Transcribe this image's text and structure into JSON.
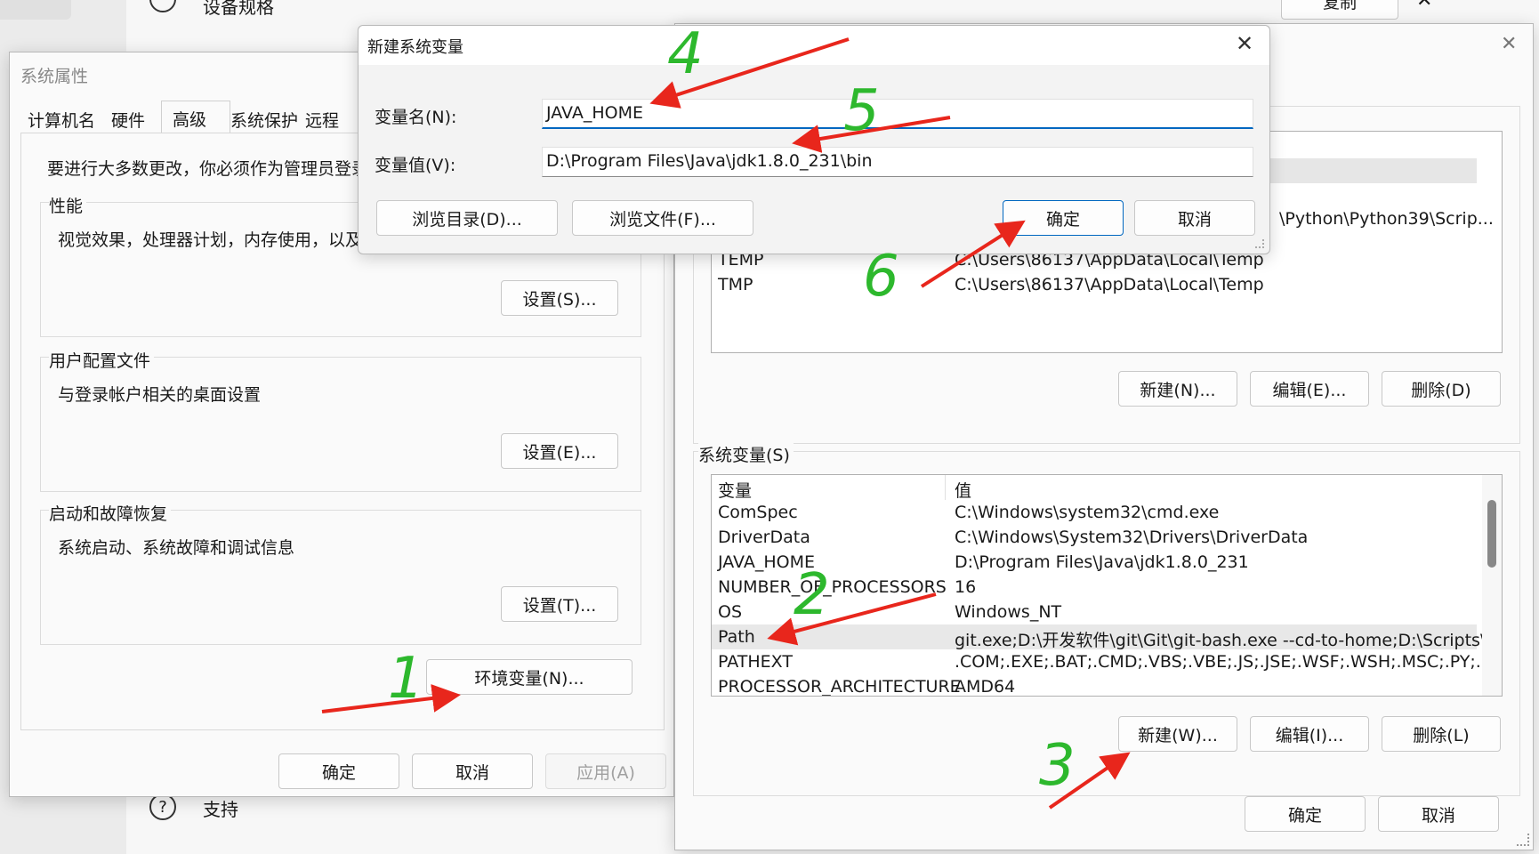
{
  "background_app": {
    "device_specs_label": "设备规格",
    "copy_button": "复制",
    "support_label": "支持",
    "close_glyph": "✕"
  },
  "system_properties": {
    "title": "系统属性",
    "tabs": [
      "计算机名",
      "硬件",
      "高级",
      "系统保护",
      "远程"
    ],
    "admin_notice": "要进行大多数更改，你必须作为管理员登录。",
    "performance": {
      "label": "性能",
      "description": "视觉效果，处理器计划，内存使用，以及虚",
      "button": "设置(S)..."
    },
    "user_profiles": {
      "label": "用户配置文件",
      "description": "与登录帐户相关的桌面设置",
      "button": "设置(E)..."
    },
    "startup_recovery": {
      "label": "启动和故障恢复",
      "description": "系统启动、系统故障和调试信息",
      "button": "设置(T)..."
    },
    "env_button": "环境变量(N)...",
    "ok": "确定",
    "cancel": "取消",
    "apply": "应用(A)"
  },
  "env_vars": {
    "close_glyph": "✕",
    "user_vars": {
      "rows": [
        {
          "name": "",
          "value": "\\Python\\Python39\\Scrip..."
        },
        {
          "name": "TEMP",
          "value": "C:\\Users\\86137\\AppData\\Local\\Temp"
        },
        {
          "name": "TMP",
          "value": "C:\\Users\\86137\\AppData\\Local\\Temp"
        }
      ],
      "new": "新建(N)...",
      "edit": "编辑(E)...",
      "delete": "删除(D)"
    },
    "system_vars": {
      "label": "系统变量(S)",
      "col_name": "变量",
      "col_value": "值",
      "rows": [
        {
          "name": "ComSpec",
          "value": "C:\\Windows\\system32\\cmd.exe"
        },
        {
          "name": "DriverData",
          "value": "C:\\Windows\\System32\\Drivers\\DriverData"
        },
        {
          "name": "JAVA_HOME",
          "value": "D:\\Program Files\\Java\\jdk1.8.0_231"
        },
        {
          "name": "NUMBER_OF_PROCESSORS",
          "value": "16"
        },
        {
          "name": "OS",
          "value": "Windows_NT"
        },
        {
          "name": "Path",
          "value": "git.exe;D:\\开发软件\\git\\Git\\git-bash.exe --cd-to-home;D:\\Scripts\\;D..."
        },
        {
          "name": "PATHEXT",
          "value": ".COM;.EXE;.BAT;.CMD;.VBS;.VBE;.JS;.JSE;.WSF;.WSH;.MSC;.PY;.PYW"
        },
        {
          "name": "PROCESSOR_ARCHITECTURE",
          "value": "AMD64"
        }
      ],
      "new": "新建(W)...",
      "edit": "编辑(I)...",
      "delete": "删除(L)"
    },
    "ok": "确定",
    "cancel": "取消"
  },
  "new_var_dialog": {
    "title": "新建系统变量",
    "close_glyph": "✕",
    "name_label": "变量名(N):",
    "name_value": "JAVA_HOME",
    "value_label": "变量值(V):",
    "value_value": "D:\\Program Files\\Java\\jdk1.8.0_231\\bin",
    "browse_dir": "浏览目录(D)...",
    "browse_file": "浏览文件(F)...",
    "ok": "确定",
    "cancel": "取消"
  },
  "annotations": {
    "color_arrow": "#e8261c",
    "color_number": "#2db82d",
    "labels": [
      "1",
      "2",
      "3",
      "4",
      "5",
      "6"
    ]
  }
}
